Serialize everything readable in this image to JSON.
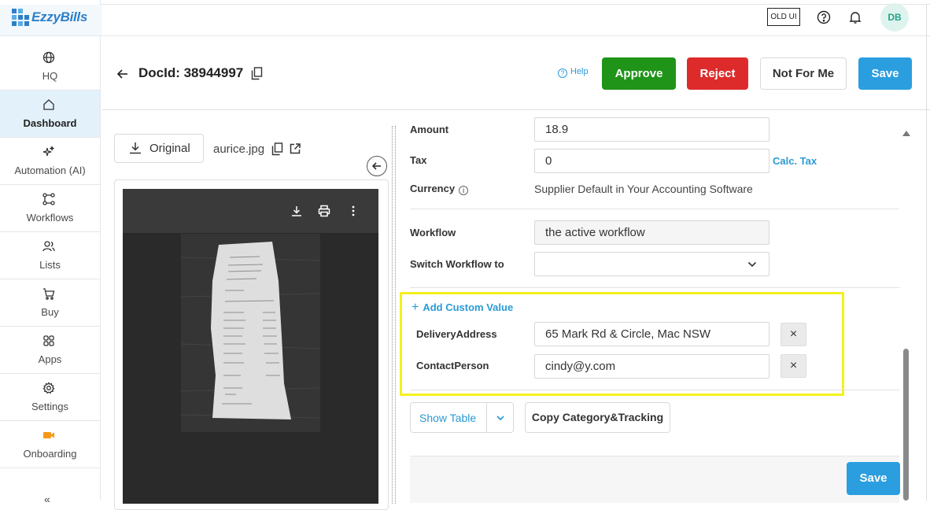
{
  "app": {
    "name": "EzzyBills"
  },
  "sidebar": {
    "items": [
      {
        "label": "HQ",
        "icon": "globe-icon"
      },
      {
        "label": "Dashboard",
        "icon": "home-icon",
        "active": true
      },
      {
        "label": "Automation (AI)",
        "icon": "sparkle-icon"
      },
      {
        "label": "Workflows",
        "icon": "workflow-icon"
      },
      {
        "label": "Lists",
        "icon": "users-icon"
      },
      {
        "label": "Buy",
        "icon": "cart-icon"
      },
      {
        "label": "Apps",
        "icon": "apps-grid-icon"
      },
      {
        "label": "Settings",
        "icon": "gear-icon"
      },
      {
        "label": "Onboarding",
        "icon": "video-icon"
      }
    ],
    "collapse": "«"
  },
  "topbar": {
    "old_ui": "OLD UI",
    "avatar": "DB"
  },
  "doc": {
    "title": "DocId: 38944997",
    "help": "Help",
    "buttons": {
      "approve": "Approve",
      "reject": "Reject",
      "not_for_me": "Not For Me",
      "save": "Save"
    }
  },
  "viewer": {
    "original": "Original",
    "filename": "aurice.jpg"
  },
  "form": {
    "amount_label": "Amount",
    "amount_value": "18.9",
    "tax_label": "Tax",
    "tax_value": "0",
    "calc_tax": "Calc. Tax",
    "currency_label": "Currency",
    "currency_value": "Supplier Default in Your Accounting Software",
    "workflow_label": "Workflow",
    "workflow_value": "the active workflow",
    "switch_label": "Switch Workflow to",
    "switch_value": "",
    "add_custom": "Add Custom Value",
    "custom": [
      {
        "label": "DeliveryAddress",
        "value": "65 Mark Rd & Circle, Mac NSW"
      },
      {
        "label": "ContactPerson",
        "value": "cindy@y.com"
      }
    ],
    "show_table": "Show Table",
    "copy_category": "Copy Category&Tracking",
    "save": "Save"
  },
  "colors": {
    "approve": "#1f9418",
    "reject": "#dd2b2b",
    "primary": "#2b9ee0",
    "highlight": "#f5f01d"
  }
}
